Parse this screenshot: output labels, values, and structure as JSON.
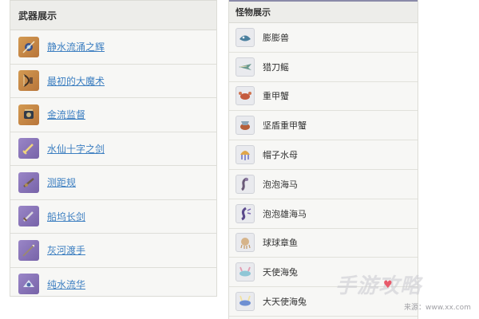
{
  "weapons": {
    "title": "武器展示",
    "items": [
      {
        "label": "静水流涌之辉",
        "icon": "catalyst-icon"
      },
      {
        "label": "最初的大魔术",
        "icon": "bow-icon"
      },
      {
        "label": "金流监督",
        "icon": "catalyst-icon"
      },
      {
        "label": "水仙十字之剑",
        "icon": "sword-icon"
      },
      {
        "label": "测距规",
        "icon": "bow-icon"
      },
      {
        "label": "船坞长剑",
        "icon": "sword-icon"
      },
      {
        "label": "灰河渡手",
        "icon": "polearm-icon"
      },
      {
        "label": "纯水流华",
        "icon": "catalyst-icon"
      }
    ]
  },
  "monsters": {
    "title": "怪物展示",
    "items": [
      {
        "label": "膨膨兽"
      },
      {
        "label": "猎刀鳐"
      },
      {
        "label": "重甲蟹"
      },
      {
        "label": "坚盾重甲蟹"
      },
      {
        "label": "帽子水母"
      },
      {
        "label": "泡泡海马"
      },
      {
        "label": "泡泡雄海马"
      },
      {
        "label": "球球章鱼"
      },
      {
        "label": "天使海兔"
      },
      {
        "label": "大天使海兔"
      }
    ]
  },
  "watermark": {
    "title": "手游攻略",
    "url": "来源：www.xx.com"
  },
  "colors": {
    "link": "#3d7fc1",
    "gold_rarity": "#c58746",
    "purple_rarity": "#8a75b8"
  }
}
